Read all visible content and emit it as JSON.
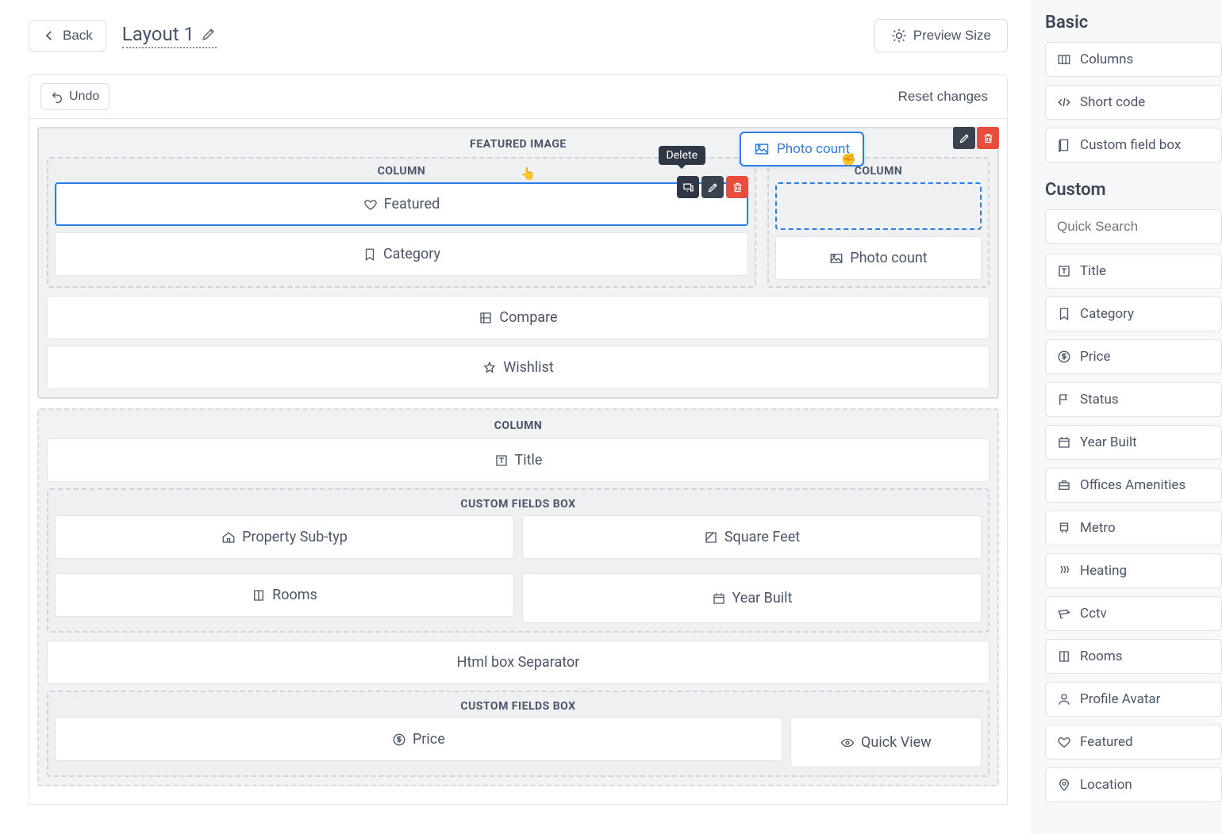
{
  "header": {
    "back": "Back",
    "title": "Layout 1",
    "preview": "Preview Size"
  },
  "toolbar": {
    "undo": "Undo",
    "reset": "Reset changes"
  },
  "tooltip_delete": "Delete",
  "drag_chip": "Photo count",
  "sections": {
    "featured_image": {
      "title": "FEATURED IMAGE",
      "col_label": "COLUMN",
      "left": {
        "featured": "Featured",
        "category": "Category"
      },
      "right": {
        "photo_count": "Photo count"
      },
      "compare": "Compare",
      "wishlist": "Wishlist"
    },
    "column2": {
      "title": "COLUMN",
      "title_field": "Title",
      "cfbox1_title": "CUSTOM FIELDS BOX",
      "prop_subtype": "Property Sub-typ",
      "square_feet": "Square Feet",
      "rooms": "Rooms",
      "year_built": "Year Built",
      "html_sep": "Html box Separator",
      "cfbox2_title": "CUSTOM FIELDS BOX",
      "price": "Price",
      "quick_view": "Quick View"
    }
  },
  "sidebar": {
    "basic_title": "Basic",
    "basic_items": {
      "columns": "Columns",
      "short_code": "Short code",
      "custom_field_box": "Custom field box"
    },
    "custom_title": "Custom",
    "search_placeholder": "Quick Search",
    "custom_items": {
      "title": "Title",
      "category": "Category",
      "price": "Price",
      "status": "Status",
      "year_built": "Year Built",
      "offices_amenities": "Offices Amenities",
      "metro": "Metro",
      "heating": "Heating",
      "cctv": "Cctv",
      "rooms": "Rooms",
      "profile_avatar": "Profile Avatar",
      "featured": "Featured",
      "location": "Location"
    }
  }
}
